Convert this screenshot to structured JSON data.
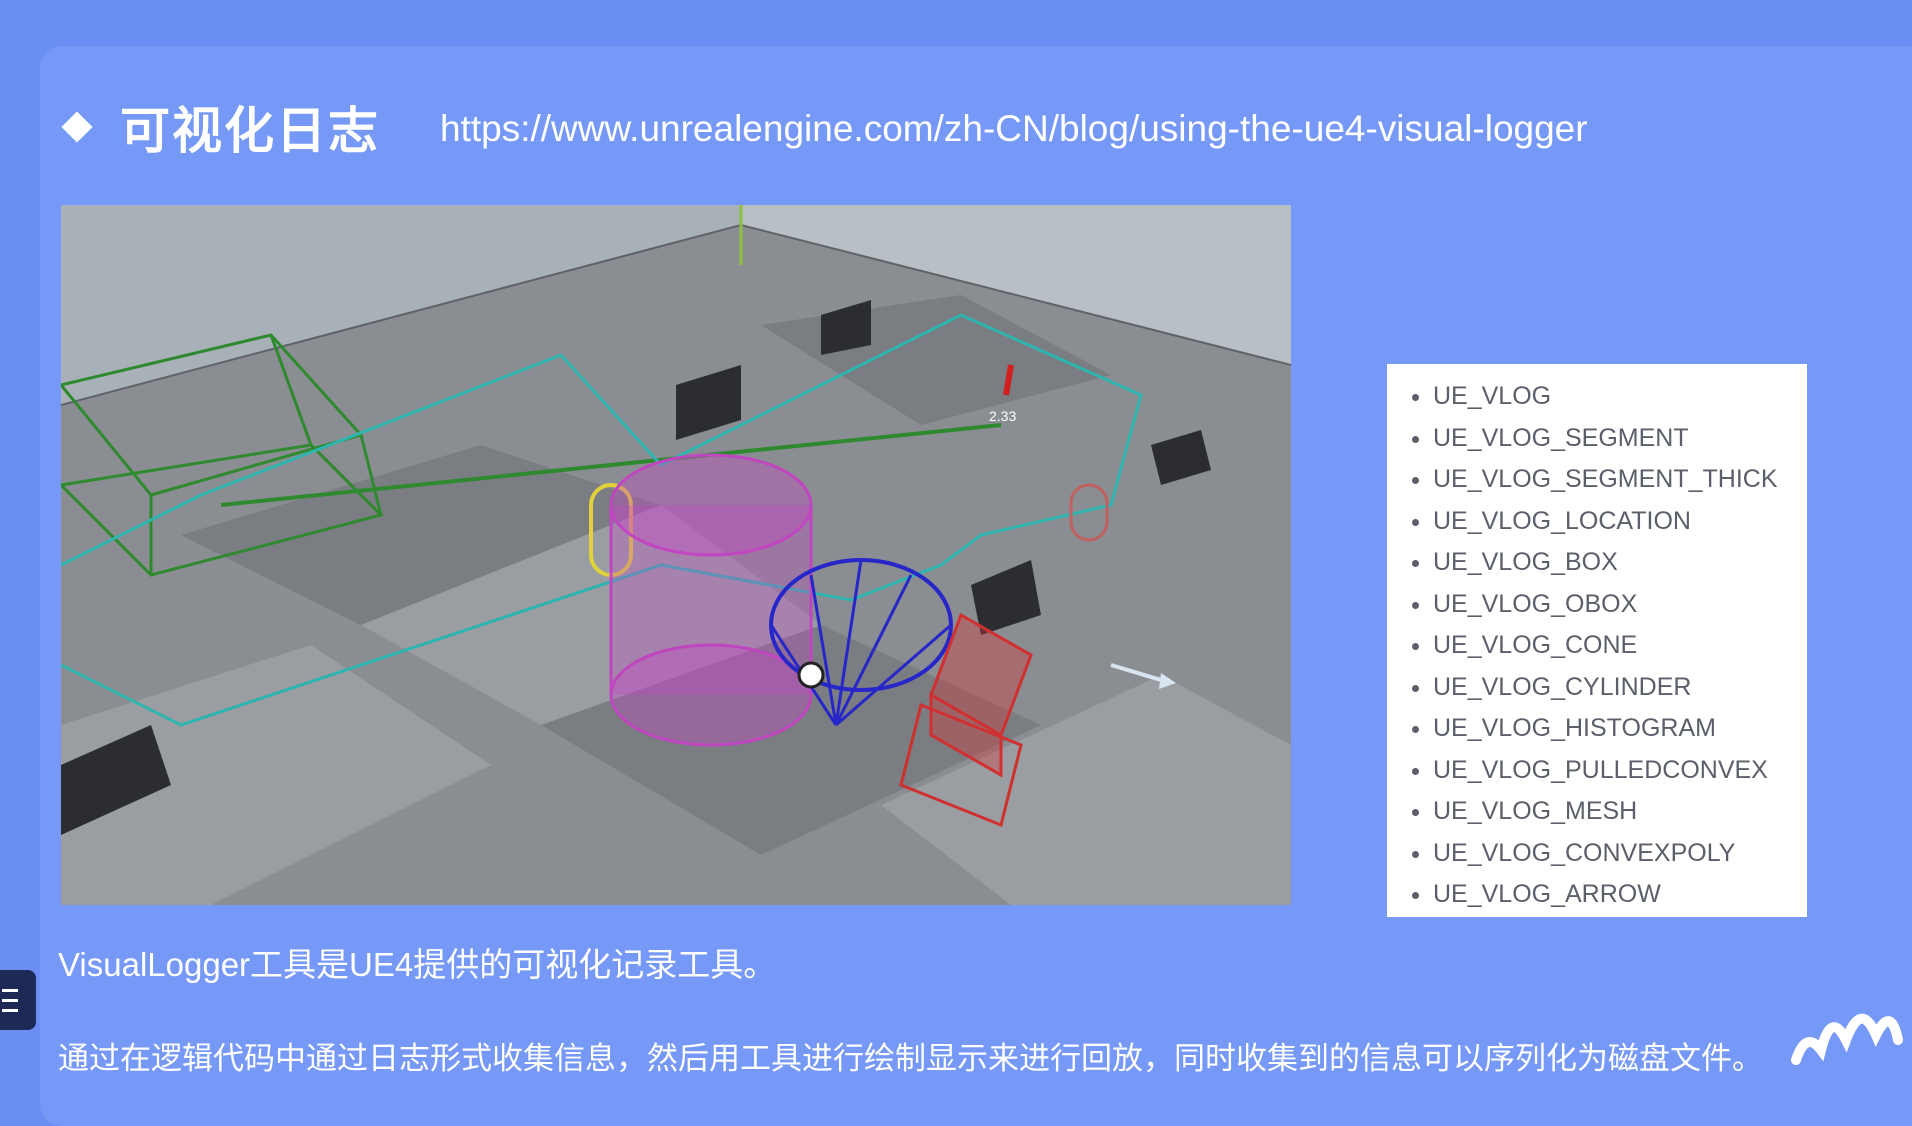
{
  "slide": {
    "title": "可视化日志",
    "url": "https://www.unrealengine.com/zh-CN/blog/using-the-ue4-visual-logger"
  },
  "scene": {
    "label_value": "2.33"
  },
  "macros": [
    "UE_VLOG",
    "UE_VLOG_SEGMENT",
    "UE_VLOG_SEGMENT_THICK",
    "UE_VLOG_LOCATION",
    "UE_VLOG_BOX",
    "UE_VLOG_OBOX",
    "UE_VLOG_CONE",
    "UE_VLOG_CYLINDER",
    "UE_VLOG_HISTOGRAM",
    "UE_VLOG_PULLEDCONVEX",
    "UE_VLOG_MESH",
    "UE_VLOG_CONVEXPOLY",
    "UE_VLOG_ARROW"
  ],
  "body": {
    "line1": "VisualLogger工具是UE4提供的可视化记录工具。",
    "line2": "通过在逻辑代码中通过日志形式收集信息，然后用工具进行绘制显示来进行回放，同时收集到的信息可以序列化为磁盘文件。"
  },
  "colors": {
    "background": "#6b8ef5",
    "slide": "#7698f6",
    "text": "#ffffff"
  },
  "icons": [
    "menu-icon",
    "brand-logo-icon"
  ]
}
